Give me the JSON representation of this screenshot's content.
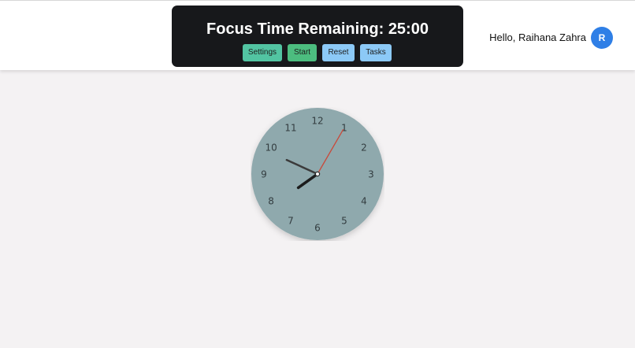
{
  "header": {
    "timer_title": "Focus Time Remaining: 25:00",
    "buttons": {
      "settings": "Settings",
      "start": "Start",
      "reset": "Reset",
      "tasks": "Tasks"
    },
    "greeting": "Hello, Raihana Zahra",
    "avatar_initial": "R"
  },
  "clock": {
    "numbers": [
      "12",
      "1",
      "2",
      "3",
      "4",
      "5",
      "6",
      "7",
      "8",
      "9",
      "10",
      "11"
    ],
    "time": {
      "hour": 7,
      "minute": 49,
      "second": 5
    },
    "face_color": "#8fa9ad",
    "hour_hand_color": "#1c1c1c",
    "minute_hand_color": "#3b3b3b",
    "second_hand_color": "#c9493a"
  },
  "colors": {
    "background": "#f4f2f3",
    "panel": "#17181b",
    "settings_button": "#52c4a2",
    "start_button": "#4cbd7f",
    "reset_button": "#8cc9f7",
    "tasks_button": "#8cc9f7",
    "avatar": "#2f7fe6"
  }
}
